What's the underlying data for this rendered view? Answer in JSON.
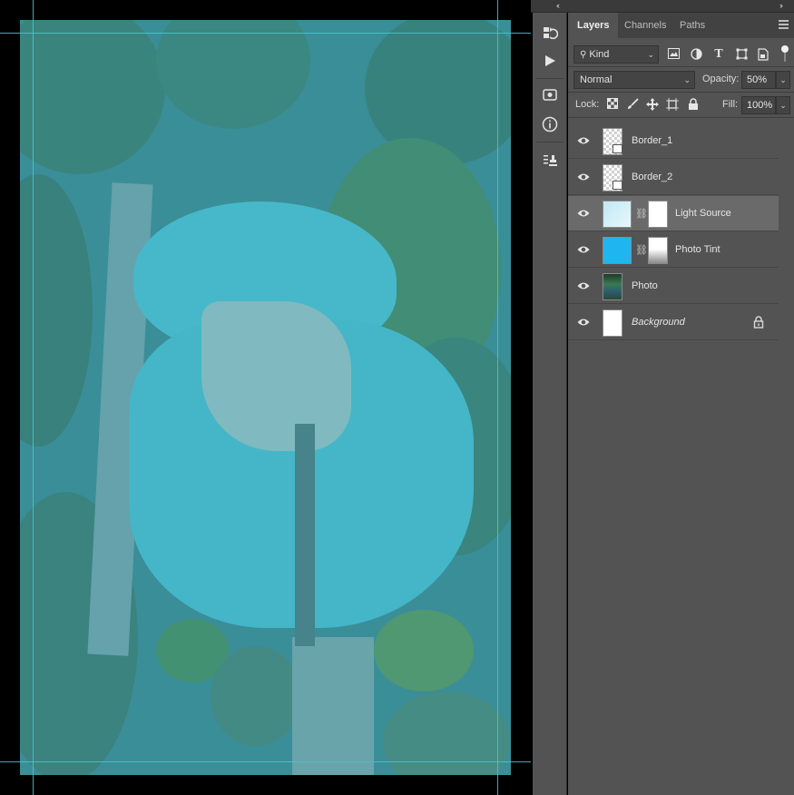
{
  "document": {
    "description_colors": {
      "overlay": "#5abec8",
      "guides": "#49c7cf"
    }
  },
  "dock": {
    "collapse_left": "‹‹",
    "collapse_right": "››"
  },
  "tools": [
    {
      "name": "history-icon"
    },
    {
      "name": "play-action-icon"
    },
    {
      "name": "3d-icon"
    },
    {
      "name": "info-icon"
    },
    {
      "name": "clone-source-icon"
    }
  ],
  "panel": {
    "tabs": [
      "Layers",
      "Channels",
      "Paths"
    ],
    "active_tab": "Layers",
    "filter": {
      "kind_label": "Kind"
    },
    "blend_mode": "Normal",
    "opacity_label": "Opacity:",
    "opacity_value": "50%",
    "lock_label": "Lock:",
    "fill_label": "Fill:",
    "fill_value": "100%"
  },
  "layers": [
    {
      "name": "Border_1",
      "thumb": "checker",
      "selected": false
    },
    {
      "name": "Border_2",
      "thumb": "checker",
      "selected": false
    },
    {
      "name": "Light Source",
      "thumb": "light",
      "selected": true,
      "mask": "white"
    },
    {
      "name": "Photo Tint",
      "thumb": "cyan",
      "selected": false,
      "mask": "gradient"
    },
    {
      "name": "Photo",
      "thumb": "photo",
      "selected": false
    },
    {
      "name": "Background",
      "thumb": "white",
      "selected": false,
      "locked": true
    }
  ],
  "colors": {
    "accent_cyan": "#1fb5f0",
    "panel_bg": "#535353",
    "selected_row": "#6a6a6a"
  }
}
